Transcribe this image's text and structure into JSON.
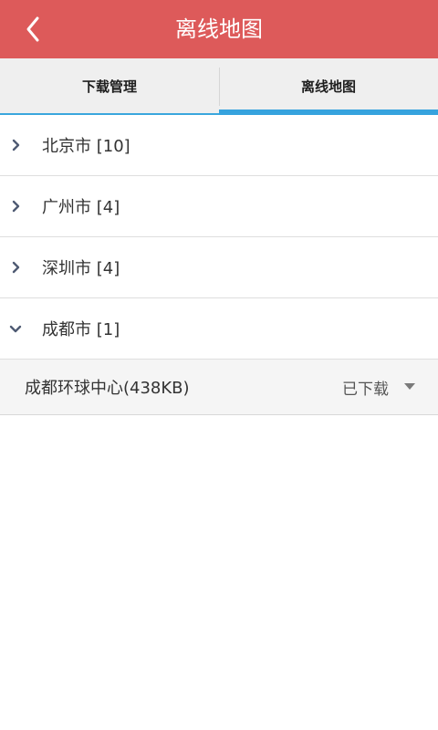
{
  "header": {
    "title": "离线地图",
    "back_icon": "chevron-left-icon"
  },
  "tabs": [
    {
      "label": "下载管理",
      "active": false
    },
    {
      "label": "离线地图",
      "active": true
    }
  ],
  "cities": [
    {
      "label": "北京市 [10]",
      "expanded": false
    },
    {
      "label": "广州市 [4]",
      "expanded": false
    },
    {
      "label": "深圳市 [4]",
      "expanded": false
    },
    {
      "label": "成都市 [1]",
      "expanded": true
    }
  ],
  "expanded_item": {
    "name": "成都环球中心(438KB)",
    "status": "已下载",
    "dropdown_icon": "triangle-down-icon"
  },
  "colors": {
    "header_bg": "#dd5a5a",
    "tab_indicator": "#36a3de",
    "chevron": "#4f5b73"
  }
}
